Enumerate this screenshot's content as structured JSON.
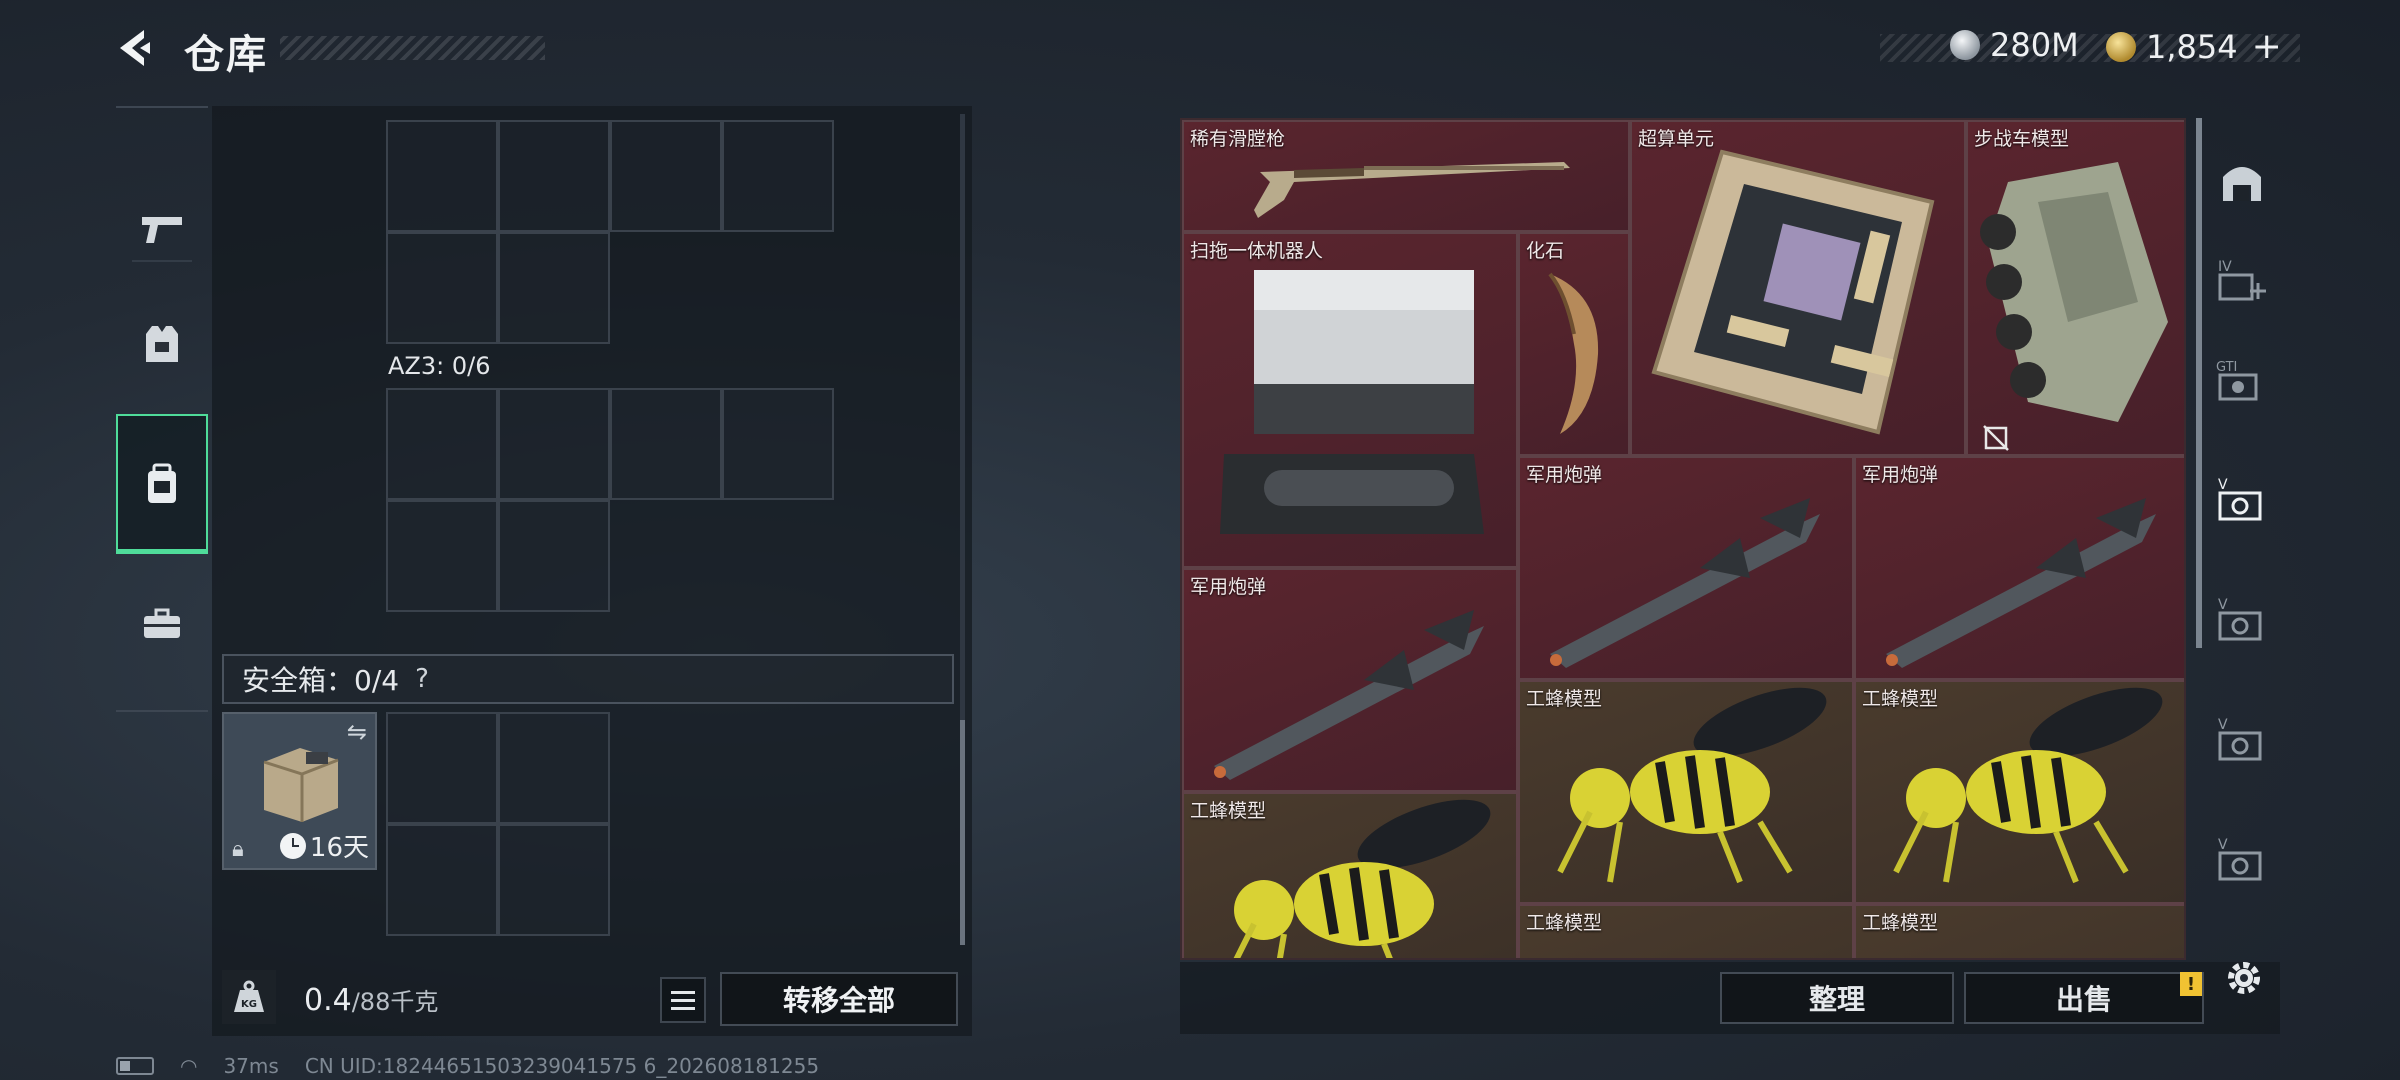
{
  "header": {
    "title": "仓库",
    "currency_silver": "280M",
    "currency_gold": "1,854",
    "plus_label": "+"
  },
  "left_rail": {
    "categories": [
      {
        "name": "weapons",
        "icon": "pistol-icon"
      },
      {
        "name": "armor",
        "icon": "vest-icon"
      },
      {
        "name": "backpack",
        "icon": "backpack-icon",
        "active": true
      },
      {
        "name": "case",
        "icon": "briefcase-icon"
      }
    ]
  },
  "containers": {
    "az3_label": "AZ3: 0/6",
    "safe_label": "安全箱：0/4",
    "safe_help": "?",
    "safe_item_days": "16天"
  },
  "bottom_left": {
    "weight_icon_label": "KG",
    "weight_value": "0.4",
    "weight_capacity": "/88千克",
    "transfer_all": "转移全部"
  },
  "stash": {
    "items": [
      {
        "name": "稀有滑膛枪"
      },
      {
        "name": "超算单元"
      },
      {
        "name": "步战车模型"
      },
      {
        "name": "扫拖一体机器人"
      },
      {
        "name": "化石"
      },
      {
        "name": "军用炮弹"
      },
      {
        "name": "军用炮弹"
      },
      {
        "name": "军用炮弹"
      },
      {
        "name": "工蜂模型"
      },
      {
        "name": "工蜂模型"
      },
      {
        "name": "工蜂模型"
      },
      {
        "name": "工蜂模型"
      },
      {
        "name": "工蜂模型"
      }
    ],
    "sort_label": "整理",
    "sell_label": "出售",
    "sell_badge": "!"
  },
  "right_rail": {
    "tabs": [
      "stash-home-icon",
      "IV+",
      "GTI",
      "V",
      "V",
      "V",
      "V"
    ]
  },
  "status_bar": {
    "ping": "37ms",
    "uid": "CN UID:18244651503239041575 6_202608181255"
  },
  "colors": {
    "accent_green": "#4fdc9a",
    "stash_red": "#4e222b",
    "stash_olive": "#3f3329",
    "badge_yellow": "#f1c232"
  }
}
